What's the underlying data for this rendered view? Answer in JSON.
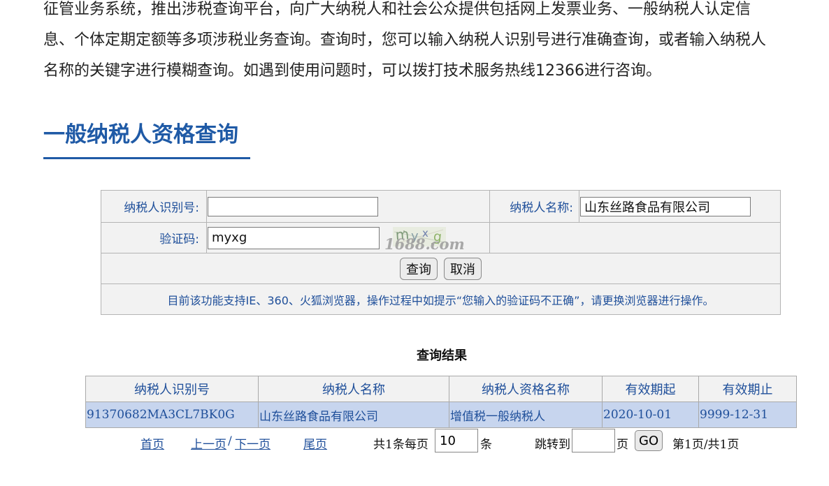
{
  "intro": {
    "line1": "征管业务系统，推出涉税查询平台，向广大纳税人和社会公众提供包括网上发票业务、一般纳税人认定信",
    "line2": "息、个体定期定额等多项涉税业务查询。查询时，您可以输入纳税人识别号进行准确查询，或者输入纳税人",
    "line3": "名称的关键字进行模糊查询。如遇到使用问题时，可以拨打技术服务热线12366进行咨询。"
  },
  "section_title": "一般纳税人资格查询",
  "form": {
    "taxpayer_id_label": "纳税人识别号:",
    "taxpayer_id_value": "",
    "taxpayer_name_label": "纳税人名称:",
    "taxpayer_name_value": "山东丝路食品有限公司",
    "captcha_label": "验证码:",
    "captcha_value": "myxg",
    "captcha_image_text": "myxg",
    "query_button": "查询",
    "cancel_button": "取消",
    "notice": "目前该功能支持IE、360、火狐浏览器，操作过程中如提示“您输入的验证码不正确”，请更换浏览器进行操作。"
  },
  "watermark": "1688.com",
  "results": {
    "title": "查询结果",
    "headers": [
      "纳税人识别号",
      "纳税人名称",
      "纳税人资格名称",
      "有效期起",
      "有效期止"
    ],
    "rows": [
      [
        "91370682MA3CL7BK0G",
        "山东丝路食品有限公司",
        "增值税一般纳税人",
        "2020-10-01",
        "9999-12-31"
      ]
    ]
  },
  "pagination": {
    "first": "首页",
    "prev": "上一页",
    "separator": "/",
    "next": "下一页",
    "last": "尾页",
    "total_prefix": "共1条每页",
    "page_size": "10",
    "per_page_unit": "条",
    "jump_label": "跳转到",
    "jump_value": "",
    "page_unit": "页",
    "go_button": "GO",
    "page_info": "第1页/共1页"
  },
  "colors": {
    "title_blue": "#1f5aa6",
    "label_blue": "#1f4f9a",
    "row_highlight": "#c7d5ee",
    "form_bg": "#f2f2f2"
  }
}
